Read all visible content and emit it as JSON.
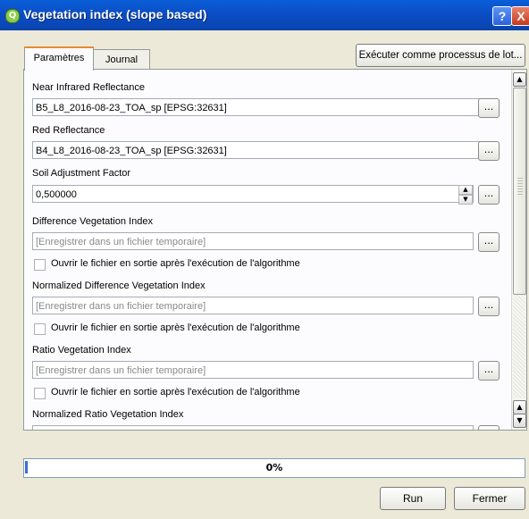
{
  "window": {
    "title": "Vegetation index (slope based)",
    "help": "?",
    "close": "X",
    "app_icon": "Q"
  },
  "tabs": [
    {
      "label": "Paramètres",
      "active": true
    },
    {
      "label": "Journal",
      "active": false
    }
  ],
  "batch_button": "Exécuter comme processus de lot...",
  "params": {
    "nir_label": "Near Infrared Reflectance",
    "nir_value": "B5_L8_2016-08-23_TOA_sp [EPSG:32631]",
    "red_label": "Red Reflectance",
    "red_value": "B4_L8_2016-08-23_TOA_sp [EPSG:32631]",
    "soil_label": "Soil Adjustment Factor",
    "soil_value": "0,500000",
    "dvi_label": "Difference Vegetation Index",
    "ndvi_label": "Normalized Difference Vegetation Index",
    "rvi_label": "Ratio Vegetation Index",
    "nrvi_label": "Normalized Ratio Vegetation Index",
    "output_placeholder": "[Enregistrer dans un fichier temporaire]",
    "open_output_label": "Ouvrir le fichier en sortie après l'exécution de l'algorithme",
    "browse": "..."
  },
  "progress": {
    "value": 0,
    "text": "0%"
  },
  "buttons": {
    "run": "Run",
    "close": "Fermer"
  },
  "colors": {
    "titlebar": "#0a5fd8",
    "progress": "#3c6fd1"
  }
}
